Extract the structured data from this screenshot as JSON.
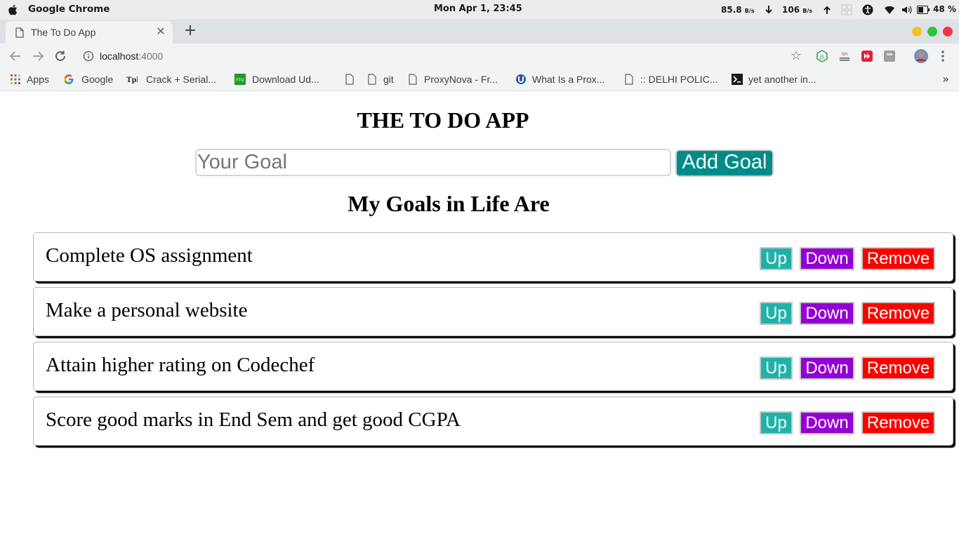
{
  "os_bar": {
    "app_name": "Google Chrome",
    "clock": "Mon Apr  1, 23:45",
    "net_down": "85.8",
    "net_down_unit": "B/s",
    "net_up": "106",
    "net_up_unit": "B/s",
    "battery": "48 %"
  },
  "browser": {
    "tab_title": "The To Do App",
    "url_host": "localhost",
    "url_port": ":4000",
    "bookmarks": [
      {
        "label": "Apps",
        "icon": "apps-grid-icon"
      },
      {
        "label": "Google",
        "icon": "google-icon"
      },
      {
        "label": "Crack + Serial...",
        "icon": "tpb-icon"
      },
      {
        "label": "Download Ud...",
        "icon": "ftu-icon"
      },
      {
        "label": "",
        "icon": "page-icon"
      },
      {
        "label": "git",
        "icon": "page-icon"
      },
      {
        "label": "ProxyNova - Fr...",
        "icon": "page-icon"
      },
      {
        "label": "What Is a Prox...",
        "icon": "proxy-icon"
      },
      {
        "label": ":: DELHI POLIC...",
        "icon": "page-icon"
      },
      {
        "label": "yet another in...",
        "icon": "terminal-icon"
      }
    ]
  },
  "app": {
    "title": "THE TO DO APP",
    "input_placeholder": "Your Goal",
    "add_button": "Add Goal",
    "subheading": "My Goals in Life Are",
    "goals": [
      {
        "text": "Complete OS assignment",
        "up": "Up",
        "down": "Down",
        "remove": "Remove"
      },
      {
        "text": "Make a personal website",
        "up": "Up",
        "down": "Down",
        "remove": "Remove"
      },
      {
        "text": "Attain higher rating on Codechef",
        "up": "Up",
        "down": "Down",
        "remove": "Remove"
      },
      {
        "text": "Score good marks in End Sem and get good CGPA",
        "up": "Up",
        "down": "Down",
        "remove": "Remove"
      }
    ]
  },
  "colors": {
    "add_button": "#008b8b",
    "up_button": "#20b2aa",
    "down_button": "#9400d3",
    "remove_button": "#ff0000"
  }
}
